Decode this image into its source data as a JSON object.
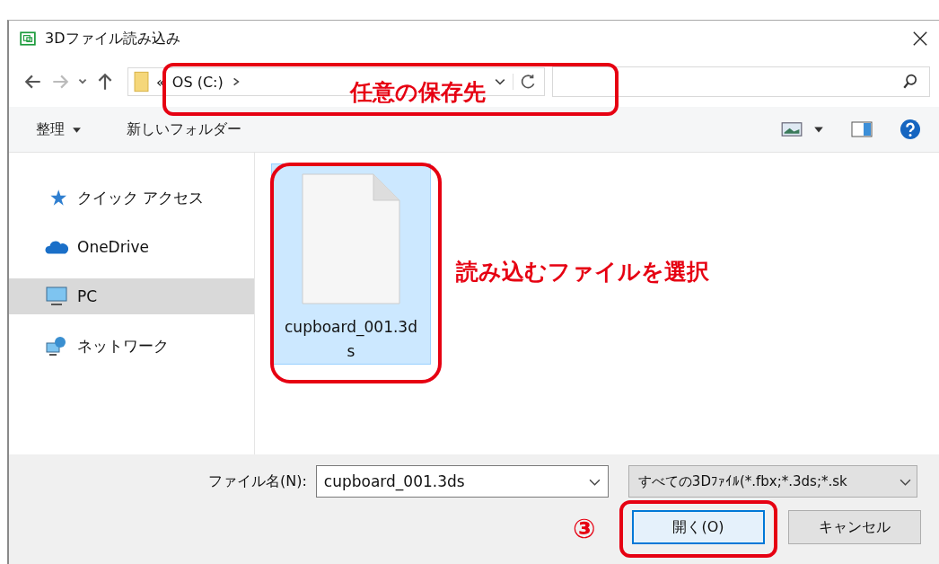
{
  "window": {
    "title": "3Dファイル読み込み"
  },
  "address_bar": {
    "overflow": "«",
    "path": "OS (C:)"
  },
  "toolbar": {
    "organize": "整理",
    "new_folder": "新しいフォルダー"
  },
  "sidebar": {
    "items": [
      {
        "label": "クイック アクセス",
        "kind": "star",
        "selected": false
      },
      {
        "label": "OneDrive",
        "kind": "cloud",
        "selected": false
      },
      {
        "label": "PC",
        "kind": "monitor",
        "selected": true
      },
      {
        "label": "ネットワーク",
        "kind": "network",
        "selected": false
      }
    ]
  },
  "files": [
    {
      "name": "cupboard_001.3ds",
      "selected": true
    }
  ],
  "file_name": {
    "label": "ファイル名(N):",
    "value": "cupboard_001.3ds"
  },
  "file_type": {
    "value": "すべての3Dﾌｧｲﾙ(*.fbx;*.3ds;*.sk"
  },
  "buttons": [
    {
      "label": "開く(O)",
      "kind": "primary"
    },
    {
      "label": "キャンセル",
      "kind": "normal"
    }
  ],
  "annotations": [
    {
      "text": "任意の保存先",
      "kind": "address"
    },
    {
      "text": "読み込むファイルを選択",
      "kind": "file"
    },
    {
      "text": "③",
      "kind": "open"
    }
  ]
}
